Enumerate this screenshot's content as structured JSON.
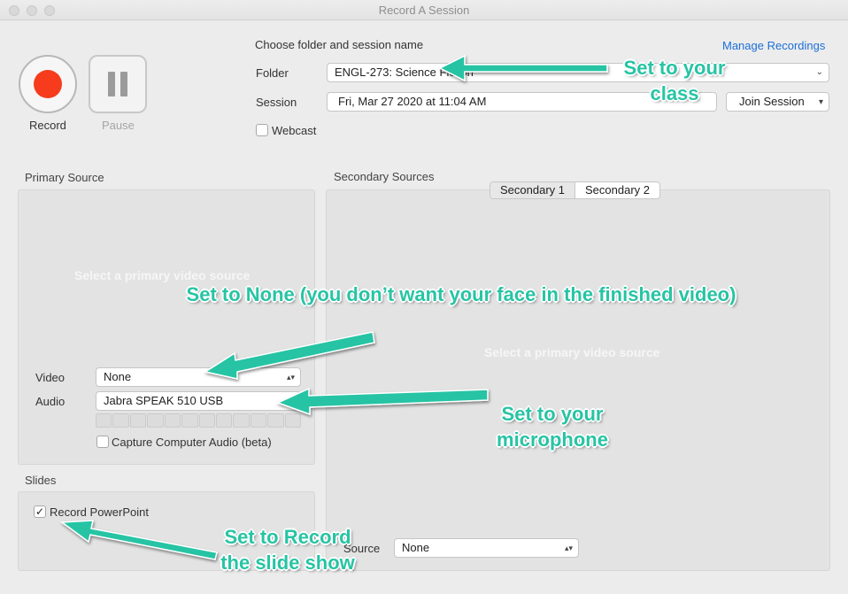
{
  "window": {
    "title": "Record A Session"
  },
  "controls": {
    "record_label": "Record",
    "pause_label": "Pause"
  },
  "header": {
    "choose_label": "Choose folder and session name",
    "manage_link": "Manage Recordings",
    "folder_label": "Folder",
    "folder_value": "ENGL-273: Science Fiction",
    "session_label": "Session",
    "session_value": "Fri, Mar 27 2020 at 11:04 AM",
    "join_button": "Join Session",
    "webcast_label": "Webcast"
  },
  "primary": {
    "title": "Primary Source",
    "placeholder": "Select a primary video source",
    "video_label": "Video",
    "video_value": "None",
    "audio_label": "Audio",
    "audio_value": "Jabra SPEAK 510 USB",
    "capture_audio_label": "Capture Computer Audio (beta)"
  },
  "slides": {
    "title": "Slides",
    "record_ppt_label": "Record PowerPoint",
    "record_ppt_checked": "✓"
  },
  "secondary": {
    "title": "Secondary Sources",
    "tabs": [
      "Secondary 1",
      "Secondary 2"
    ],
    "placeholder": "Select a primary video source",
    "source_label": "Source",
    "source_value": "None"
  },
  "annotations": {
    "class_line1": "Set to your",
    "class_line2": "class",
    "video": "Set to None (you don’t want your face in the  finished video)",
    "mic_line1": "Set to your",
    "mic_line2": "microphone",
    "slides_line1": "Set to Record",
    "slides_line2": "the slide show"
  },
  "colors": {
    "annotation": "#27c4a4",
    "record": "#f63c1d",
    "link": "#1d6fd9"
  }
}
